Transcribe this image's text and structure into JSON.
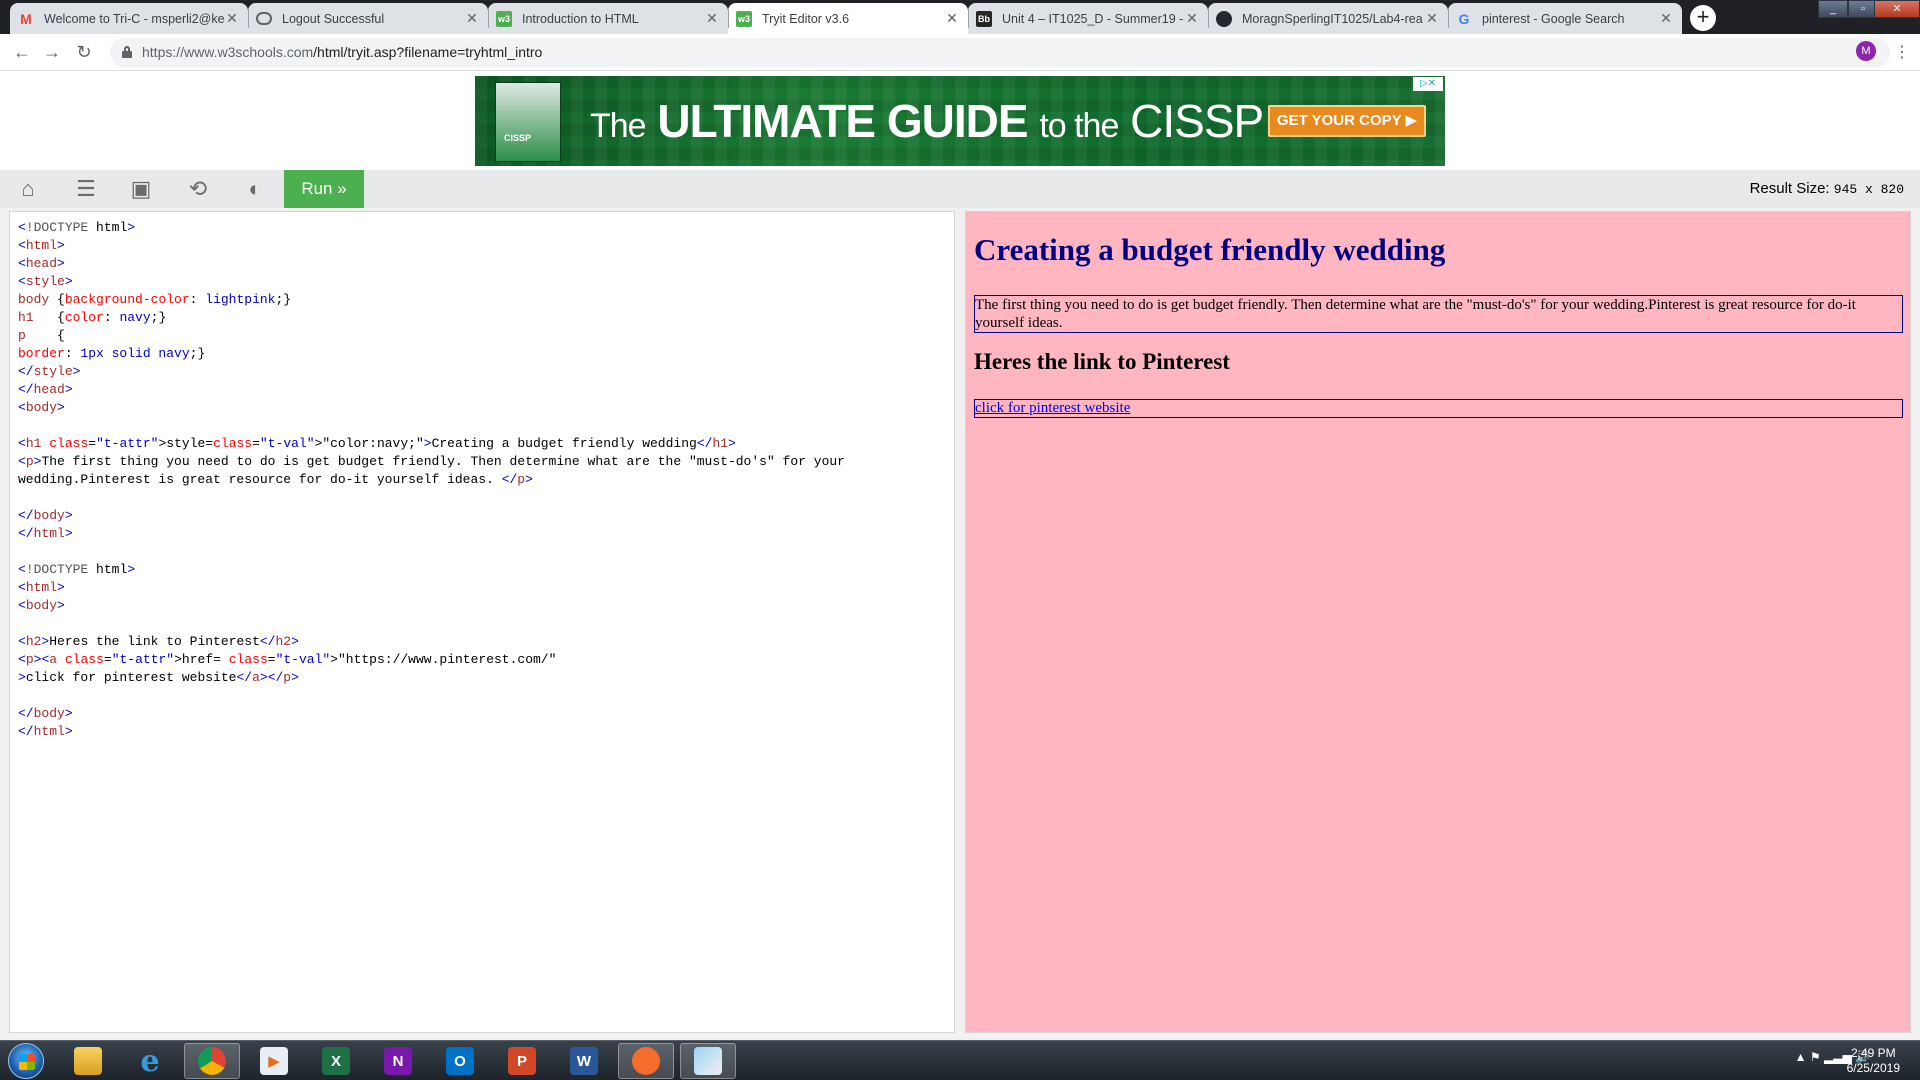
{
  "browser": {
    "tabs": [
      {
        "title": "Welcome to Tri-C - msperli2@ke",
        "favicon": "M"
      },
      {
        "title": "Logout Successful",
        "favicon": "globe"
      },
      {
        "title": "Introduction to HTML",
        "favicon": "w3"
      },
      {
        "title": "Tryit Editor v3.6",
        "favicon": "w3",
        "active": true
      },
      {
        "title": "Unit 4 – IT1025_D - Summer19 -",
        "favicon": "Bb"
      },
      {
        "title": "MoragnSperlingIT1025/Lab4-rea",
        "favicon": "github"
      },
      {
        "title": "pinterest - Google Search",
        "favicon": "G"
      }
    ],
    "url": {
      "host": "https://www.w3schools.com",
      "path": "/html/tryit.asp?filename=tryhtml_intro"
    },
    "profile_initial": "M"
  },
  "ad": {
    "word_the1": "The",
    "word_ultimate": "ULTIMATE GUIDE",
    "word_tothe": "to the",
    "word_cissp": "CISSP",
    "cta": "GET YOUR COPY ▶",
    "adchoice": "▷✕",
    "book_label": "CISSP"
  },
  "tryit": {
    "run_label": "Run »",
    "result_size_label": "Result Size:",
    "result_size_value": "945 x 820"
  },
  "code_lines": [
    "<!DOCTYPE html>",
    "<html>",
    "<head>",
    "<style>",
    "body {background-color: lightpink;}",
    "h1   {color: navy;}",
    "p    {",
    "border: 1px solid navy;}",
    "</style>",
    "</head>",
    "<body>",
    "",
    "<h1 style=\"color:navy;\">Creating a budget friendly wedding</h1>",
    "<p>The first thing you need to do is get budget friendly. Then determine what are the \"must-do's\" for your",
    "wedding.Pinterest is great resource for do-it yourself ideas. </p>",
    "",
    "</body>",
    "</html>",
    "",
    "<!DOCTYPE html>",
    "<html>",
    "<body>",
    "",
    "<h2>Heres the link to Pinterest</h2>",
    "<p><a href= \"https://www.pinterest.com/\"",
    ">click for pinterest website</a></p>",
    "",
    "</body>",
    "</html>"
  ],
  "result": {
    "h1": "Creating a budget friendly wedding",
    "p1": "The first thing you need to do is get budget friendly. Then determine what are the \"must-do's\" for your wedding.Pinterest is great resource for do-it yourself ideas.",
    "h2": "Heres the link to Pinterest",
    "link_text": "click for pinterest website",
    "bg_color": "lightpink",
    "heading_color": "navy"
  },
  "taskbar": {
    "apps": [
      {
        "name": "file-explorer",
        "label": ""
      },
      {
        "name": "internet-explorer",
        "label": "e"
      },
      {
        "name": "chrome",
        "label": "",
        "active": true
      },
      {
        "name": "media-player",
        "label": "▶"
      },
      {
        "name": "excel",
        "label": "X"
      },
      {
        "name": "onenote",
        "label": "N"
      },
      {
        "name": "outlook",
        "label": "O"
      },
      {
        "name": "powerpoint",
        "label": "P"
      },
      {
        "name": "word",
        "label": "W"
      },
      {
        "name": "origin",
        "label": ""
      },
      {
        "name": "paint",
        "label": ""
      }
    ],
    "time": "2:49 PM",
    "date": "6/25/2019"
  }
}
